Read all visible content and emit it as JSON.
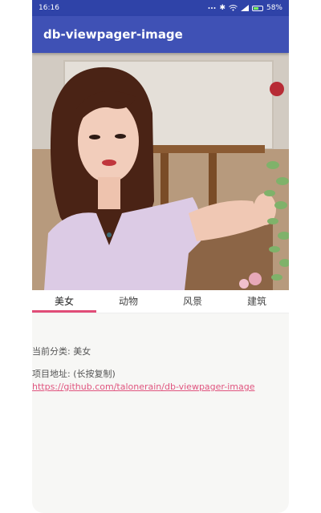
{
  "status_bar": {
    "time": "16:16",
    "battery_text": "58%",
    "battery_level": 0.58,
    "icons": [
      "bluetooth-icon",
      "wifi-icon",
      "signal-icon",
      "battery-icon"
    ]
  },
  "app_bar": {
    "title": "db-viewpager-image",
    "color": "#3f51b5"
  },
  "pager": {
    "current_index": 0,
    "image_subject": "portrait-photo"
  },
  "tabs": [
    {
      "label": "美女",
      "active": true
    },
    {
      "label": "动物",
      "active": false
    },
    {
      "label": "风景",
      "active": false
    },
    {
      "label": "建筑",
      "active": false
    }
  ],
  "accent_color": "#e04d77",
  "content": {
    "current_category_label": "当前分类: 美女",
    "project_address_label": "项目地址: (长按复制)",
    "project_url": "https://github.com/talonerain/db-viewpager-image"
  }
}
